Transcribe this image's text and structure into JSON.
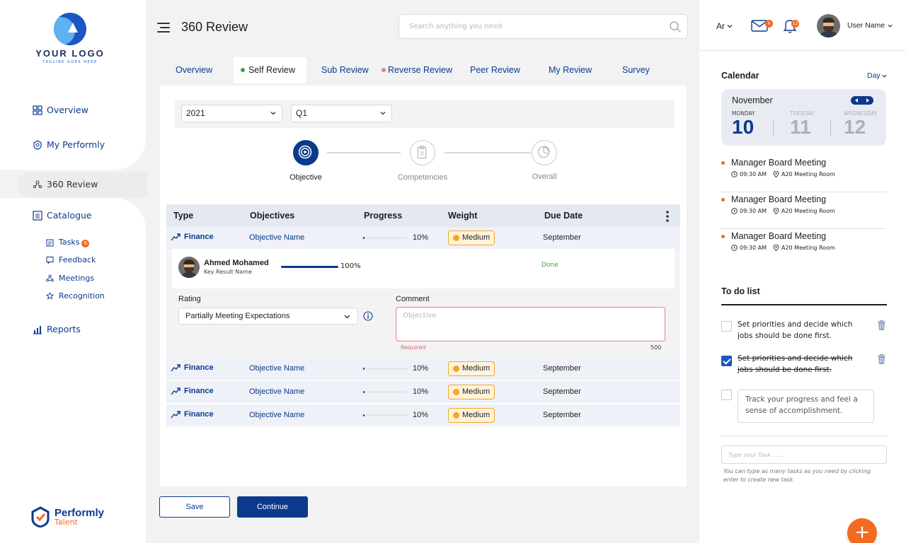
{
  "brand": {
    "logo_text": "YOUR LOGO",
    "logo_tagline": "TAGLINE GOES HERE",
    "product_name": "Performly",
    "product_sub": "Talent"
  },
  "sidebar": {
    "items": [
      {
        "label": "Overview",
        "icon": "grid-icon"
      },
      {
        "label": "My Performly",
        "icon": "badge-icon"
      },
      {
        "label": "360 Review",
        "icon": "people-icon",
        "active": true
      },
      {
        "label": "Catalogue",
        "icon": "list-icon"
      },
      {
        "label": "Reports",
        "icon": "bar-chart-icon"
      }
    ],
    "sub_items": [
      {
        "label": "Tasks",
        "icon": "task-icon",
        "badge": "6"
      },
      {
        "label": "Feedback",
        "icon": "feedback-icon"
      },
      {
        "label": "Meetings",
        "icon": "meetings-icon"
      },
      {
        "label": "Recognition",
        "icon": "star-icon"
      }
    ]
  },
  "header": {
    "title": "360 Review",
    "search_placeholder": "Search anything you need",
    "language": "Ar",
    "mail_count": "6",
    "notification_count": "12",
    "user_name": "User Name"
  },
  "tabs": [
    {
      "label": "Overview"
    },
    {
      "label": "Self Review",
      "active": true,
      "dot_color": "#3aa545"
    },
    {
      "label": "Sub Review"
    },
    {
      "label": "Reverse Review",
      "dot_color": "#e8808a"
    },
    {
      "label": "Peer Review"
    },
    {
      "label": "My Review"
    },
    {
      "label": "Survey"
    }
  ],
  "filters": {
    "year": "2021",
    "quarter": "Q1"
  },
  "stepper": [
    {
      "label": "Objective",
      "active": true
    },
    {
      "label": "Competencies"
    },
    {
      "label": "Overall"
    }
  ],
  "table": {
    "headers": [
      "Type",
      "Objectives",
      "Progress",
      "Weight",
      "Due Date"
    ],
    "rows": [
      {
        "type": "Finance",
        "objective": "Objective Name",
        "progress": 0.1,
        "progress_label": "10%",
        "weight": "Medium",
        "due": "September"
      },
      {
        "type": "Finance",
        "objective": "Objective Name",
        "progress": 0.1,
        "progress_label": "10%",
        "weight": "Medium",
        "due": "September"
      },
      {
        "type": "Finance",
        "objective": "Objective Name",
        "progress": 0.1,
        "progress_label": "10%",
        "weight": "Medium",
        "due": "September"
      },
      {
        "type": "Finance",
        "objective": "Objective Name",
        "progress": 0.1,
        "progress_label": "10%",
        "weight": "Medium",
        "due": "September"
      }
    ],
    "key_result": {
      "name": "Ahmed Mohamed",
      "sub": "Key Result Name",
      "progress": 1.0,
      "progress_label": "100%",
      "status": "Done"
    },
    "rating_label": "Rating",
    "rating_value": "Partially Meeting Expectations",
    "comment_label": "Comment",
    "comment_placeholder": "Objective",
    "comment_required": "Required",
    "comment_limit": "500"
  },
  "actions": {
    "save": "Save",
    "continue": "Continue"
  },
  "calendar": {
    "title": "Calendar",
    "mode": "Day",
    "month": "November",
    "days": [
      {
        "dow": "MONDAY",
        "num": "10",
        "active": true
      },
      {
        "dow": "TUESDAY",
        "num": "11"
      },
      {
        "dow": "WEDNESDAY",
        "num": "12"
      }
    ],
    "events": [
      {
        "title": "Manager Board Meeting",
        "time": "09:30 AM",
        "place": "A20 Meeting Room"
      },
      {
        "title": "Manager Board Meeting",
        "time": "09:30 AM",
        "place": "A20 Meeting Room"
      },
      {
        "title": "Manager Board Meeting",
        "time": "09:30 AM",
        "place": "A20 Meeting Room"
      }
    ]
  },
  "todo": {
    "title": "To do list",
    "items": [
      {
        "text": "Set priorities and decide which jobs should be done first.",
        "done": false
      },
      {
        "text": "Set priorities and decide which jobs should be done first.",
        "done": true
      },
      {
        "text": "Track your progress and feel a sense of accomplishment.",
        "done": false,
        "editing": true
      }
    ],
    "input_placeholder": "Type your Task ......",
    "hint": "You can type as many tasks as you need by clicking enter to create new task"
  },
  "colors": {
    "primary": "#0b3a8d",
    "accent": "#f26b21",
    "warning": "#f5a623",
    "success": "#3aa545",
    "error": "#e06470"
  }
}
